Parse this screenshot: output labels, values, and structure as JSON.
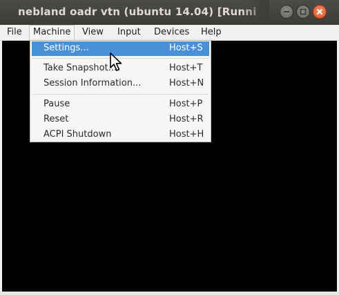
{
  "window": {
    "title": "nebland oadr vtn (ubuntu 14.04) [Runni",
    "controls": {
      "minimize_icon": "minimize-icon",
      "maximize_icon": "maximize-icon",
      "close_icon": "close-icon"
    }
  },
  "menubar": {
    "items": [
      {
        "label": "File"
      },
      {
        "label": "Machine"
      },
      {
        "label": "View"
      },
      {
        "label": "Input"
      },
      {
        "label": "Devices"
      },
      {
        "label": "Help"
      }
    ],
    "active": "Machine"
  },
  "machine_menu": {
    "items": [
      {
        "label": "Settings...",
        "shortcut": "Host+S",
        "highlighted": true
      },
      {
        "label": "Take Snapshot...",
        "shortcut": "Host+T"
      },
      {
        "label": "Session Information...",
        "shortcut": "Host+N"
      },
      {
        "label": "Pause",
        "shortcut": "Host+P"
      },
      {
        "label": "Reset",
        "shortcut": "Host+R"
      },
      {
        "label": "ACPI Shutdown",
        "shortcut": "Host+H"
      }
    ]
  },
  "colors": {
    "titlebar": "#3c3b37",
    "highlight": "#4a90d9",
    "close_button": "#e0572c",
    "vm_screen": "#000000"
  }
}
